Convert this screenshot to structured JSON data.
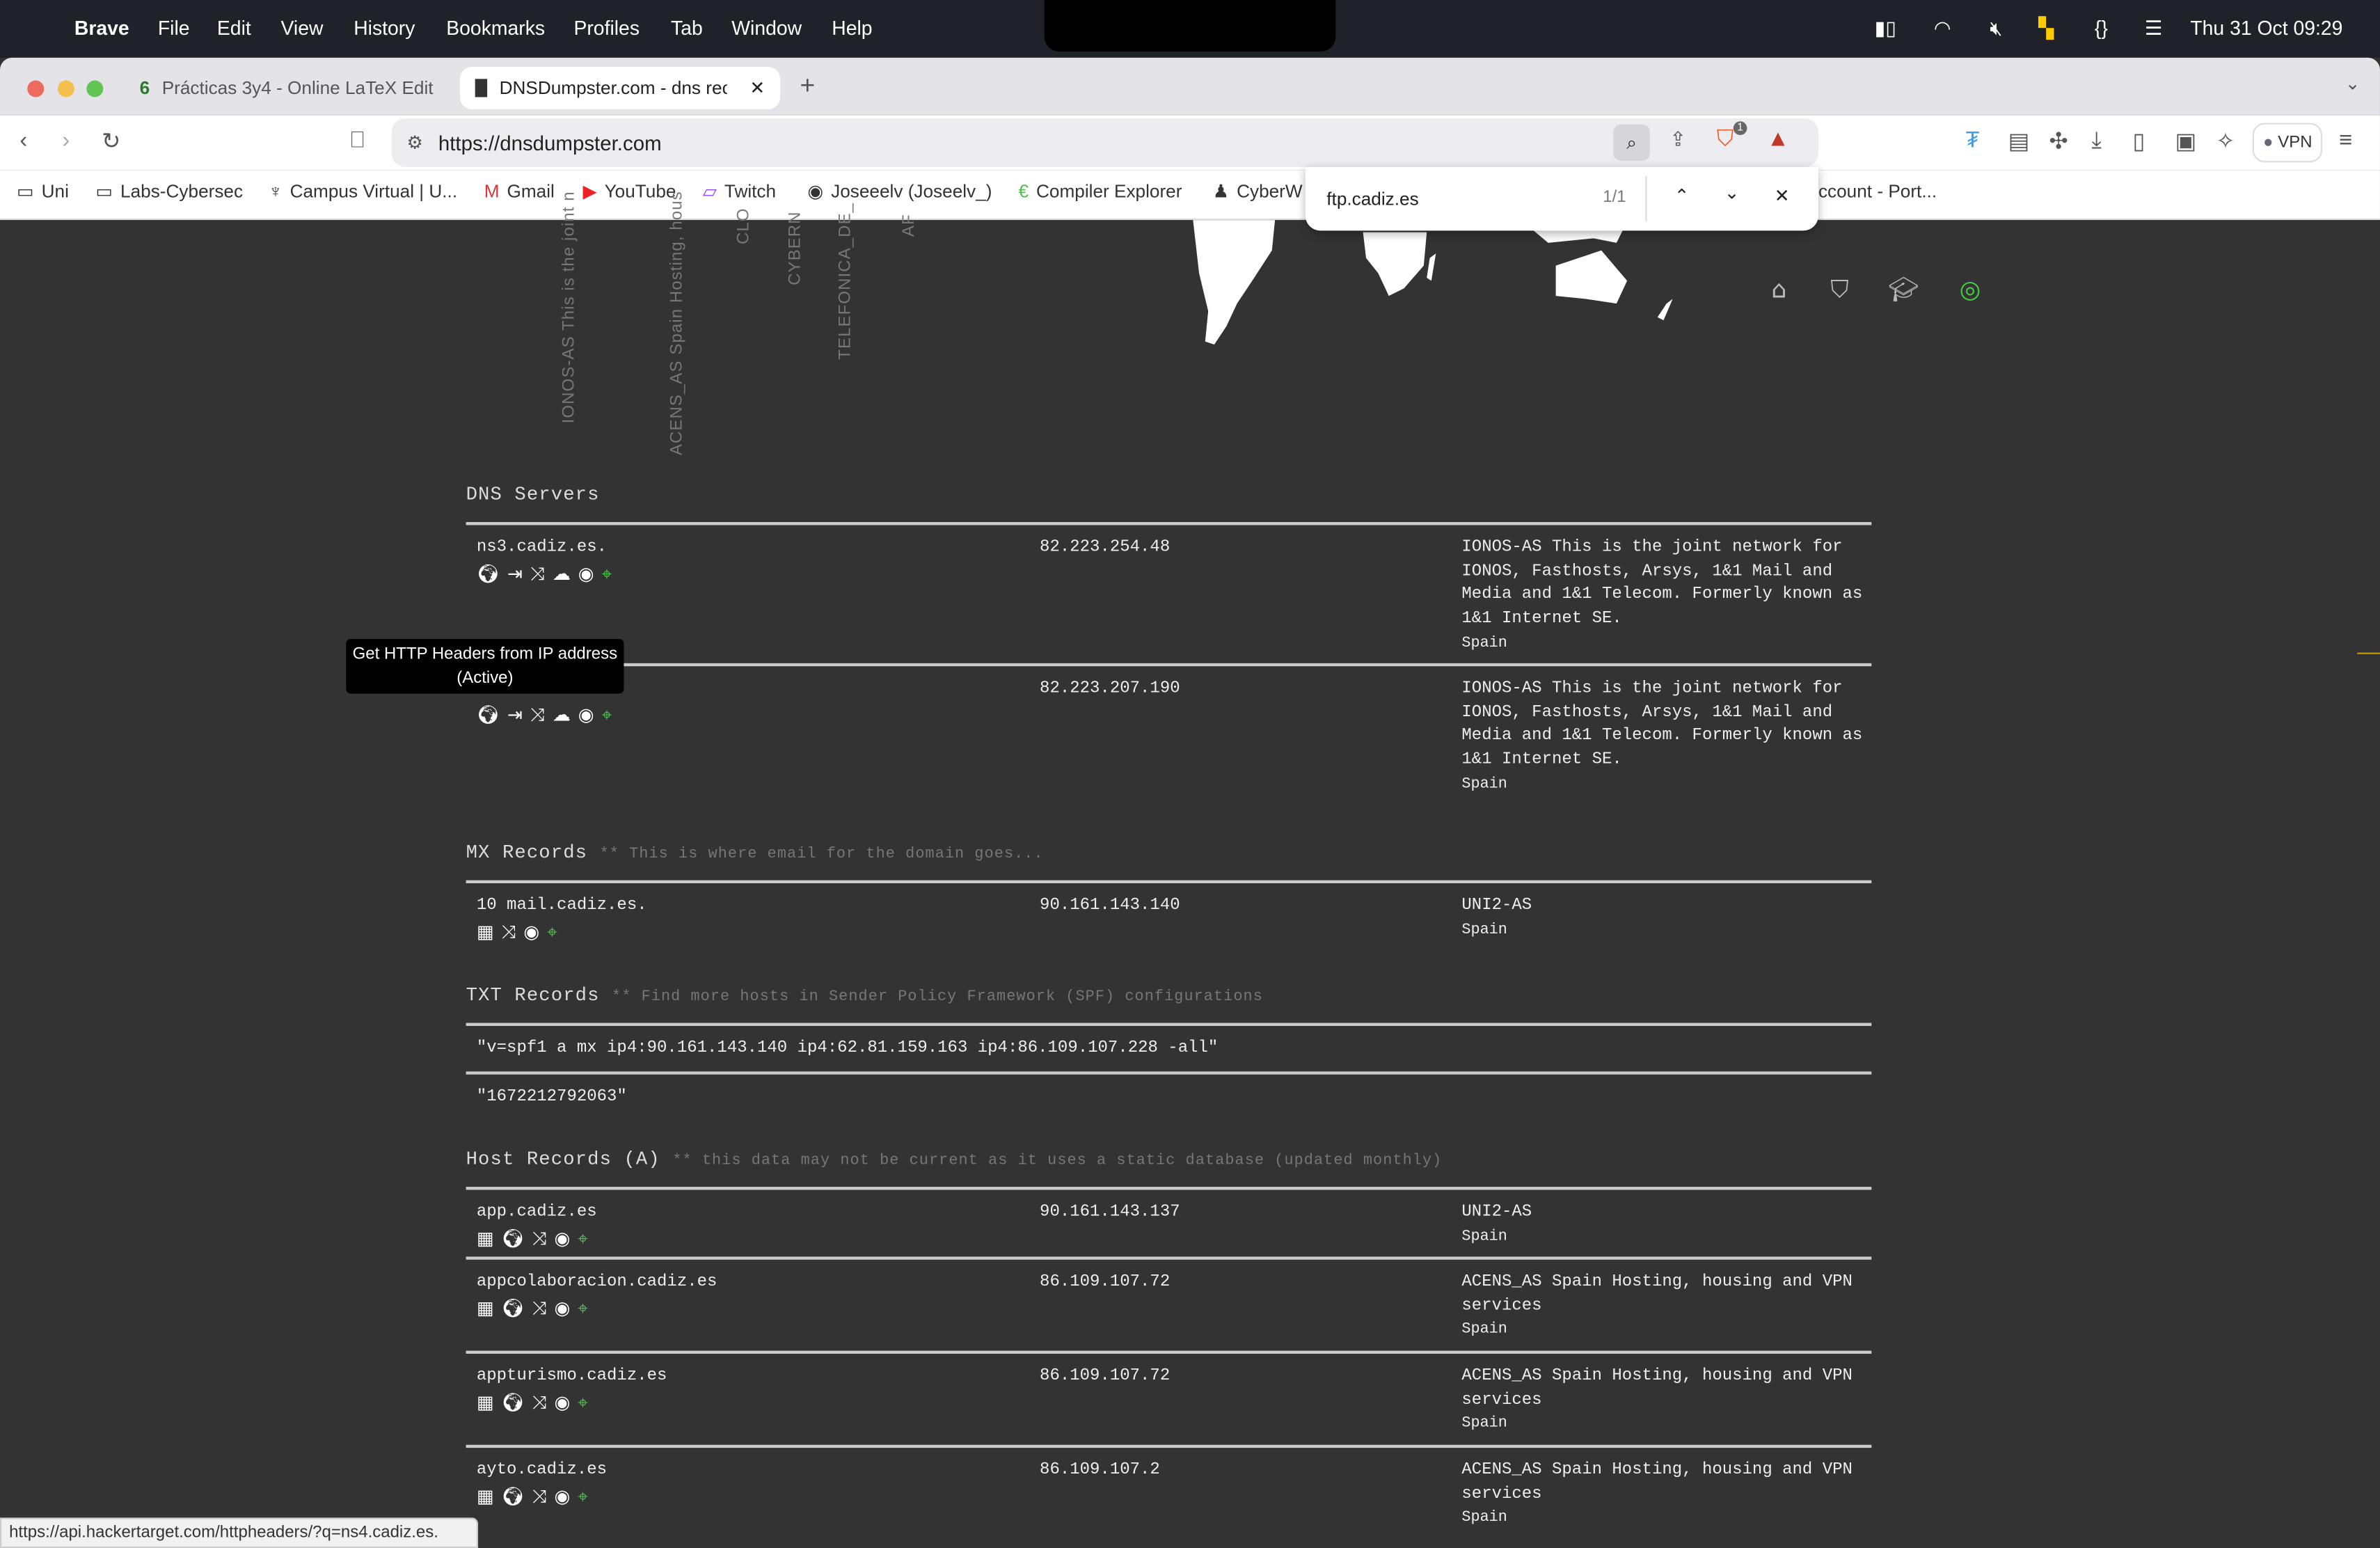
{
  "menubar": {
    "app": "Brave",
    "items": [
      "File",
      "Edit",
      "View",
      "History",
      "Bookmarks",
      "Profiles",
      "Tab",
      "Window",
      "Help"
    ],
    "clock": "Thu 31 Oct  09:29"
  },
  "tabs": [
    {
      "label": "Prácticas 3y4 - Online LaTeX Edit",
      "active": false
    },
    {
      "label": "DNSDumpster.com - dns rec",
      "active": true
    }
  ],
  "address": {
    "url": "https://dnsdumpster.com"
  },
  "toolbar": {
    "vpn_label": "VPN",
    "shield_badge": "1"
  },
  "bookmarks": [
    "Uni",
    "Labs-Cybersec",
    "Campus Virtual | U...",
    "Gmail",
    "YouTube",
    "Twitch",
    "Joseeelv (Joseelv_)",
    "Compiler Explorer",
    "CyberW",
    "ccount - Port..."
  ],
  "find": {
    "query": "ftp.cadiz.es",
    "count": "1/1"
  },
  "graph_labels": [
    "IONOS-AS This is the joint n",
    "ACENS_AS Spain Hosting, hous",
    "CLO",
    "CYBERN",
    "TELEFONICA_DE_",
    "AF"
  ],
  "dns_servers": {
    "title": "DNS Servers",
    "rows": [
      {
        "host": "ns3.cadiz.es.",
        "ip": "82.223.254.48",
        "asn": "IONOS-AS This is the joint network for IONOS, Fasthosts, Arsys, 1&1 Mail and Media and 1&1 Telecom. Formerly known as 1&1 Internet SE.",
        "country": "Spain"
      },
      {
        "host": "ns4.cadiz.es.",
        "ip": "82.223.207.190",
        "asn": "IONOS-AS This is the joint network for IONOS, Fasthosts, Arsys, 1&1 Mail and Media and 1&1 Telecom. Formerly known as 1&1 Internet SE.",
        "country": "Spain"
      }
    ]
  },
  "mx": {
    "title": "MX Records",
    "note": "** This is where email for the domain goes...",
    "rows": [
      {
        "host": "10 mail.cadiz.es.",
        "ip": "90.161.143.140",
        "asn": "UNI2-AS",
        "country": "Spain"
      }
    ]
  },
  "txt": {
    "title": "TXT Records",
    "note": "** Find more hosts in Sender Policy Framework (SPF) configurations",
    "rows": [
      "\"v=spf1 a mx ip4:90.161.143.140 ip4:62.81.159.163 ip4:86.109.107.228 -all\"",
      "\"1672212792063\""
    ]
  },
  "hosts": {
    "title": "Host Records (A)",
    "note": "** this data may not be current as it uses a static database (updated monthly)",
    "rows": [
      {
        "host": "app.cadiz.es",
        "ip": "90.161.143.137",
        "asn": "UNI2-AS",
        "country": "Spain"
      },
      {
        "host": "appcolaboracion.cadiz.es",
        "ip": "86.109.107.72",
        "asn": "ACENS_AS Spain Hosting, housing and VPN services",
        "country": "Spain"
      },
      {
        "host": "appturismo.cadiz.es",
        "ip": "86.109.107.72",
        "asn": "ACENS_AS Spain Hosting, housing and VPN services",
        "country": "Spain"
      },
      {
        "host": "ayto.cadiz.es",
        "ip": "86.109.107.2",
        "asn": "ACENS_AS Spain Hosting, housing and VPN services",
        "country": "Spain"
      }
    ]
  },
  "tooltip": "Get HTTP Headers from IP address (Active)",
  "status_url": "https://api.hackertarget.com/httpheaders/?q=ns4.cadiz.es.",
  "colors": {
    "page_bg": "#333333",
    "accent_green": "#44cc44"
  }
}
